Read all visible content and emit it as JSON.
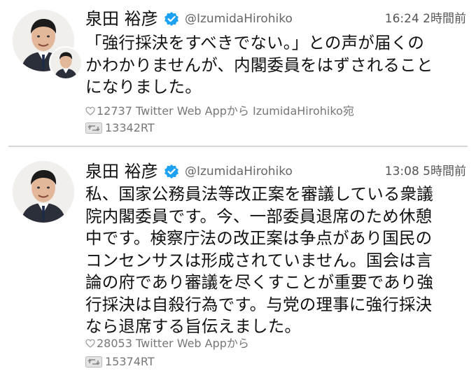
{
  "colors": {
    "verified_badge": "#1da1f2",
    "divider": "#d6d6d6",
    "secondary_text": "#777777"
  },
  "tweets": [
    {
      "name": "泉田 裕彦",
      "handle": "@IzumidaHirohiko",
      "time": "16:24 2時間前",
      "verified_icon": "verified-badge-icon",
      "body_lines": [
        "「強行採決をすべきでない。」との声が届くの",
        "かわかりませんが、内閣委員をはずされること",
        "になりました。"
      ],
      "likes": "12737",
      "source": "Twitter Web Appから IzumidaHirohiko宛",
      "retweets": "13342RT"
    },
    {
      "name": "泉田 裕彦",
      "handle": "@IzumidaHirohiko",
      "time": "13:08 5時間前",
      "verified_icon": "verified-badge-icon",
      "body_lines": [
        "私、国家公務員法等改正案を審議している衆議",
        "院内閣委員です。今、一部委員退席のため休憩",
        "中です。検察庁法の改正案は争点があり国民の",
        "コンセンサスは形成されていません。国会は言",
        "論の府であり審議を尽くすことが重要であり強",
        "行採決は自殺行為です。与党の理事に強行採決",
        "なら退席する旨伝えました。"
      ],
      "likes": "28053",
      "source": "Twitter Web Appから",
      "retweets": "15374RT"
    }
  ]
}
